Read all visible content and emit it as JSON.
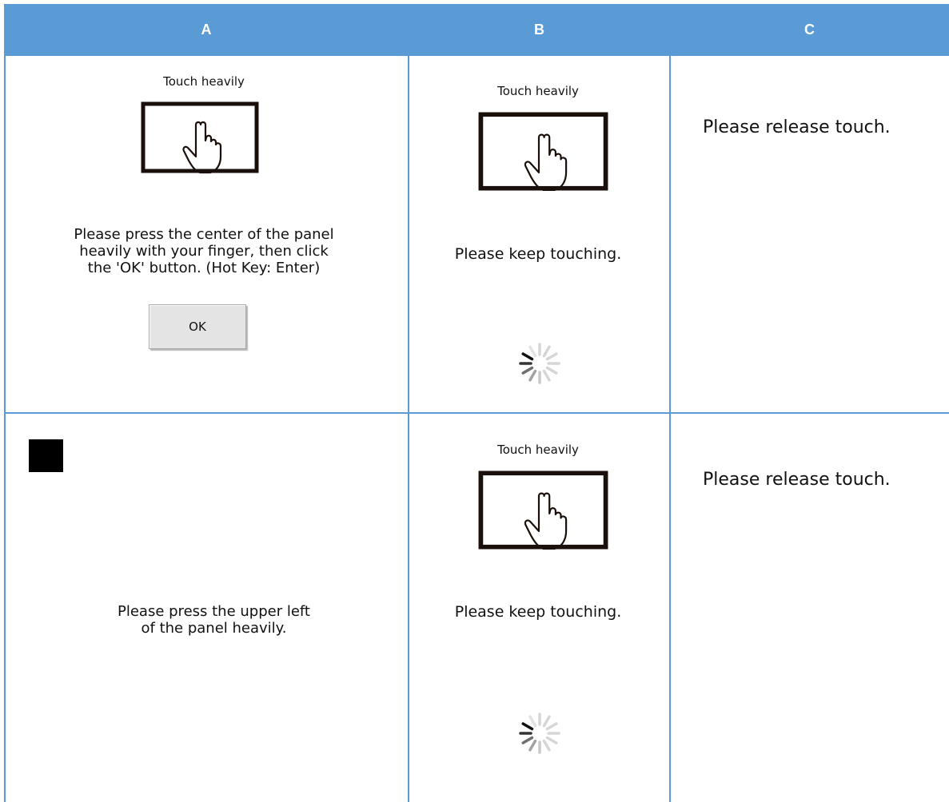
{
  "header": {
    "col_a": "A",
    "col_b": "B",
    "col_c": "C"
  },
  "row1": {
    "a": {
      "title": "Touch heavily",
      "instruction_line1": "Please press the center of the panel",
      "instruction_line2": "heavily with your finger, then click",
      "instruction_line3": "the 'OK' button. (Hot Key: Enter)",
      "ok_label": "OK",
      "icon": "touch-panel-icon"
    },
    "b": {
      "title": "Touch heavily",
      "message": "Please keep touching.",
      "icon": "touch-panel-icon",
      "spinner": "loading-spinner-icon"
    },
    "c": {
      "message": "Please release touch."
    }
  },
  "row2": {
    "a": {
      "marker": "black-square-marker",
      "instruction_line1": "Please press the upper left",
      "instruction_line2": "of the panel heavily."
    },
    "b": {
      "title": "Touch heavily",
      "message": "Please keep touching.",
      "icon": "touch-panel-icon",
      "spinner": "loading-spinner-icon"
    },
    "c": {
      "message": "Please release touch."
    }
  },
  "colors": {
    "header_bg": "#5b9bd5",
    "header_text": "#ffffff",
    "grid_line": "#5b9bd5",
    "panel_stroke": "#1a0f0a",
    "button_bg": "#e4e4e4"
  }
}
